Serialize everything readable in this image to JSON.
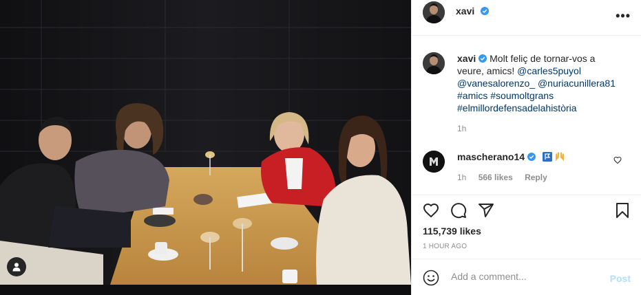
{
  "post": {
    "author": "xavi",
    "more_label": "•••",
    "caption": {
      "author": "xavi",
      "text_before": "Molt feliç de tornar-vos a veure, amics!",
      "mentions": [
        "@carles5puyol",
        "@vanesalorenzo_",
        "@nuriacunillera81"
      ],
      "hashtags": [
        "#amics",
        "#soumoltgrans",
        "#elmillordefensadelahistòria"
      ],
      "time": "1h"
    },
    "comment": {
      "author": "mascherano14",
      "time": "1h",
      "likes": "566 likes",
      "reply_label": "Reply"
    },
    "likes_count": "115,739 likes",
    "time_ago": "1 HOUR AGO",
    "add_comment_placeholder": "Add a comment...",
    "post_label": "Post"
  },
  "colors": {
    "link": "#00376b",
    "verified": "#3897f0",
    "muted": "#8e8e8e",
    "post_disabled": "#b2dffc"
  },
  "icons": [
    "verified-badge-icon",
    "more-options-icon",
    "heart-icon",
    "comment-icon",
    "share-icon",
    "save-icon",
    "emoji-icon",
    "user-tag-icon"
  ]
}
